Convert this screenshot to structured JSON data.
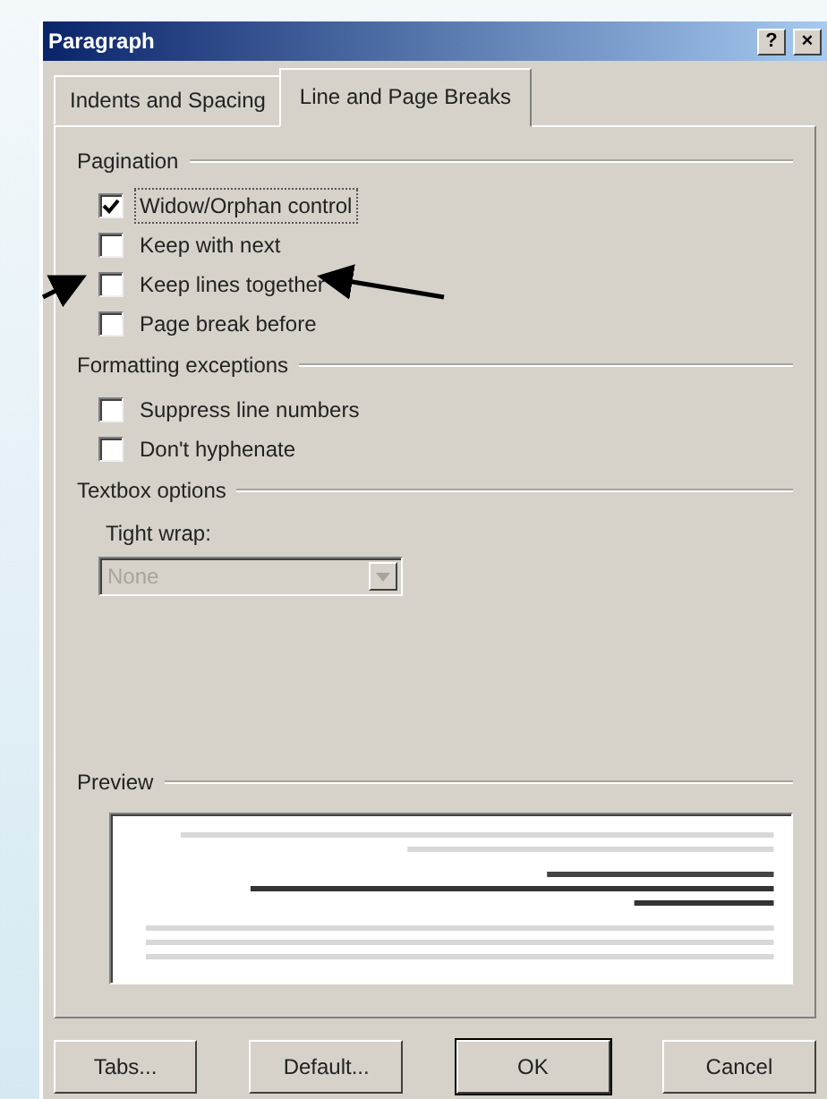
{
  "window": {
    "title": "Paragraph",
    "help_button": "?",
    "close_button": "×"
  },
  "tabs": [
    {
      "label": "Indents and Spacing",
      "selected": false
    },
    {
      "label": "Line and Page Breaks",
      "selected": true
    }
  ],
  "groups": [
    {
      "title": "Pagination",
      "items": [
        {
          "kind": "checkbox",
          "label": "Widow/Orphan control",
          "checked": true,
          "focused": true
        },
        {
          "kind": "checkbox",
          "label": "Keep with next",
          "checked": false,
          "focused": false
        },
        {
          "kind": "checkbox",
          "label": "Keep lines together",
          "checked": false,
          "focused": false
        },
        {
          "kind": "checkbox",
          "label": "Page break before",
          "checked": false,
          "focused": false
        }
      ]
    },
    {
      "title": "Formatting exceptions",
      "items": [
        {
          "kind": "checkbox",
          "label": "Suppress line numbers",
          "checked": false,
          "focused": false
        },
        {
          "kind": "checkbox",
          "label": "Don't hyphenate",
          "checked": false,
          "focused": false
        }
      ]
    },
    {
      "title": "Textbox options",
      "items": [
        {
          "kind": "dropdown",
          "label": "Tight wrap:",
          "value": "None",
          "disabled": true
        }
      ]
    }
  ],
  "preview": {
    "title": "Preview",
    "kind": "picture"
  },
  "buttons": [
    {
      "label": "Tabs...",
      "default": false
    },
    {
      "label": "Default...",
      "default": false
    },
    {
      "label": "OK",
      "default": true
    },
    {
      "label": "Cancel",
      "default": false
    }
  ]
}
